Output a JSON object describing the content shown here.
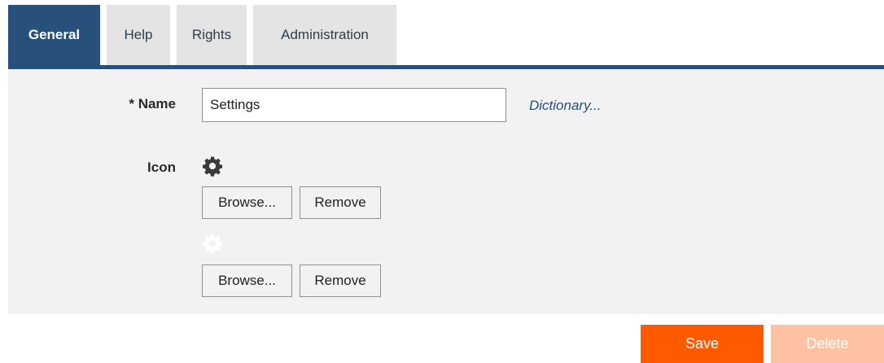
{
  "tabs": [
    {
      "label": "General",
      "active": true
    },
    {
      "label": "Help",
      "active": false
    },
    {
      "label": "Rights",
      "active": false
    },
    {
      "label": "Administration",
      "active": false
    }
  ],
  "form": {
    "name_label": "* Name",
    "name_value": "Settings",
    "dictionary_link": "Dictionary...",
    "icon_label": "Icon",
    "icons": [
      {
        "icon": "gear-icon",
        "color": "#3a3a3a",
        "browse_label": "Browse...",
        "remove_label": "Remove"
      },
      {
        "icon": "gear-icon",
        "color": "#ffffff",
        "browse_label": "Browse...",
        "remove_label": "Remove"
      }
    ]
  },
  "actions": {
    "save_label": "Save",
    "delete_label": "Delete"
  },
  "colors": {
    "accent": "#27517a",
    "panel": "#f2f2f2",
    "save": "#ff5a00",
    "delete_disabled": "#fec2a2"
  }
}
